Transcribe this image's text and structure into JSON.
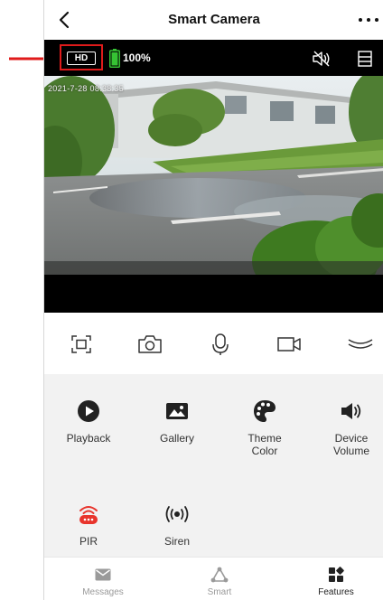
{
  "header": {
    "title": "Smart Camera",
    "back_icon": "chevron-left-icon",
    "more_icon": "more-horizontal-icon"
  },
  "statusbar": {
    "quality_label": "HD",
    "battery_text": "100%",
    "battery_level": 1.0,
    "icons": [
      "battery-icon",
      "speaker-mute-icon",
      "menu-icon"
    ]
  },
  "video": {
    "timestamp": "2021-7-28 08:38:35"
  },
  "controls": {
    "icons": [
      "screenshot-frame-icon",
      "camera-icon",
      "microphone-icon",
      "video-record-icon",
      "collapse-chevron-icon"
    ]
  },
  "features": {
    "items": [
      {
        "label": "Playback",
        "icon": "playback-icon"
      },
      {
        "label": "Gallery",
        "icon": "gallery-icon"
      },
      {
        "label": "Theme\nColor",
        "icon": "palette-icon"
      },
      {
        "label": "Device\nVolume",
        "icon": "speaker-icon"
      },
      {
        "label": "PIR",
        "icon": "pir-sensor-icon"
      },
      {
        "label": "Siren",
        "icon": "siren-icon"
      }
    ]
  },
  "bottom_nav": {
    "items": [
      {
        "label": "Messages",
        "icon": "messages-icon",
        "active": false
      },
      {
        "label": "Smart",
        "icon": "smart-icon",
        "active": false
      },
      {
        "label": "Features",
        "icon": "features-grid-icon",
        "active": true
      }
    ]
  },
  "colors": {
    "accent_red": "#e01b1b",
    "battery_green": "#36c234",
    "pir_red": "#e8342c",
    "text_dark": "#111111",
    "text_muted": "#9a9a9a"
  }
}
